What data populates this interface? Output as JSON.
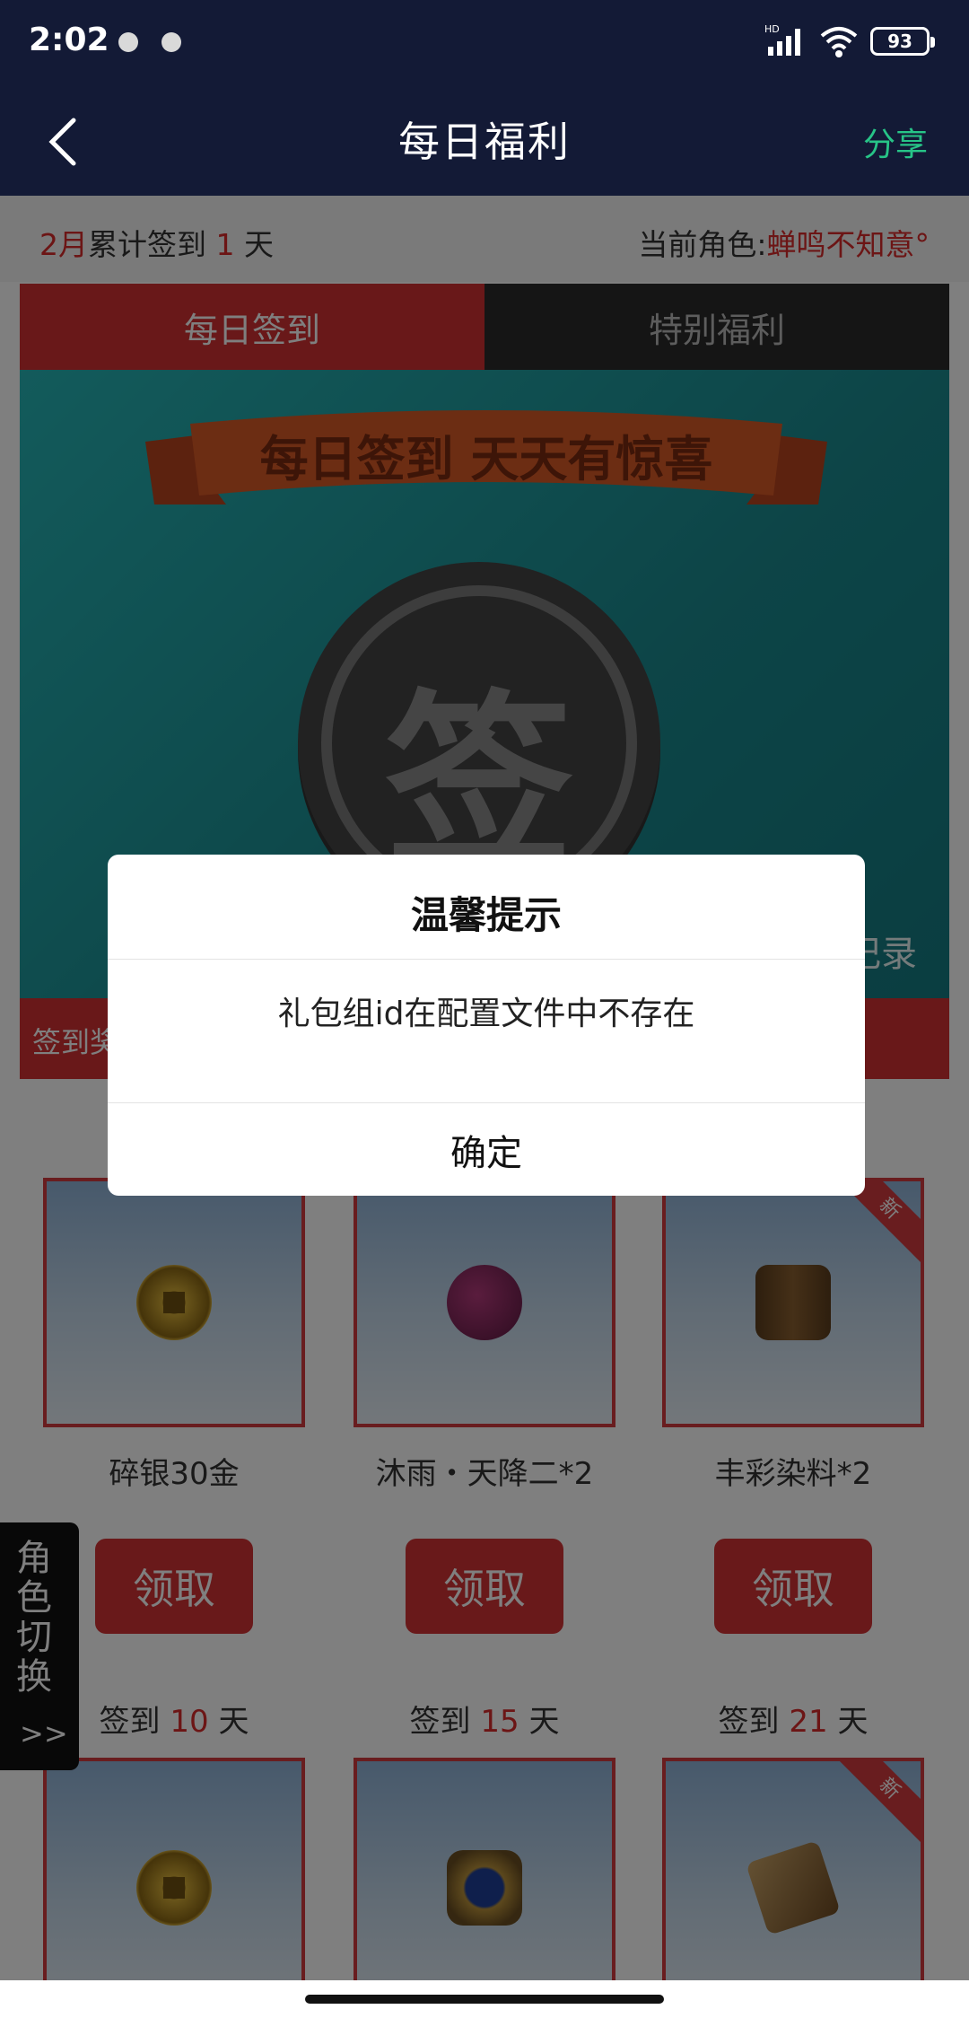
{
  "status": {
    "time": "2:02",
    "network": "HD",
    "battery": "93"
  },
  "nav": {
    "title": "每日福利",
    "share": "分享"
  },
  "info": {
    "month": "2月",
    "signed_text": "累计签到",
    "days": "1",
    "day_unit": "天",
    "role_label": "当前角色:",
    "role_name": "蝉鸣不知意°"
  },
  "tabs": [
    {
      "label": "每日签到"
    },
    {
      "label": "特别福利"
    }
  ],
  "banner": {
    "slogan": "每日签到 天天有惊喜",
    "sign_char": "签",
    "record": "记录"
  },
  "rule_bar": {
    "label": "签到奖"
  },
  "rewards_row1": [
    {
      "name": "碎银30金",
      "button": "领取",
      "new_badge": ""
    },
    {
      "name": "沐雨・天降二*2",
      "button": "领取",
      "new_badge": ""
    },
    {
      "name": "丰彩染料*2",
      "button": "领取",
      "new_badge": "新"
    }
  ],
  "rewards_row2": [
    {
      "prefix": "签到",
      "days": "10",
      "unit": "天",
      "new_badge": ""
    },
    {
      "prefix": "签到",
      "days": "15",
      "unit": "天",
      "new_badge": ""
    },
    {
      "prefix": "签到",
      "days": "21",
      "unit": "天",
      "new_badge": "新"
    }
  ],
  "role_switch": {
    "label": "角色切换",
    "arrows": ">>"
  },
  "dialog": {
    "title": "温馨提示",
    "message": "礼包组id在配置文件中不存在",
    "confirm": "确定"
  }
}
